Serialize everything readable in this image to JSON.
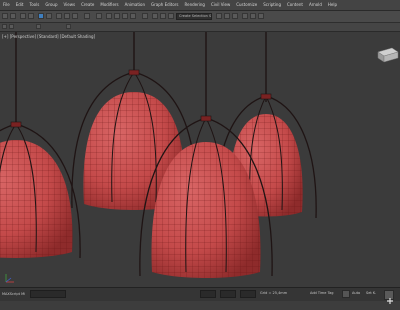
{
  "menu": {
    "items": [
      "File",
      "Edit",
      "Tools",
      "Group",
      "Views",
      "Create",
      "Modifiers",
      "Animation",
      "Graph Editors",
      "Rendering",
      "Civil View",
      "Customize",
      "Scripting",
      "Content",
      "Arnold",
      "Help"
    ]
  },
  "toolbar": {
    "selection_set_text": "Create Selection Se"
  },
  "viewport": {
    "label": "[+] [Perspective] [Standard] [Default Shading]",
    "lamp_color": "#c44a4a",
    "wire_color": "#6a1414",
    "frame_color": "#1f1414",
    "background_color": "#3b3b3b"
  },
  "statusbar": {
    "script_label": "MAXScript Mi",
    "grid_text": "Grid = 25,4mm",
    "add_time_tag": "Add Time Tag",
    "auto_label": "Auto",
    "set_key_label": "Set K."
  }
}
